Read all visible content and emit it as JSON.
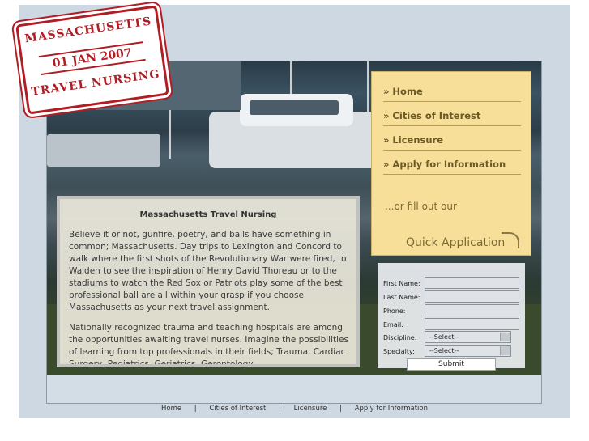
{
  "stamp": {
    "line1": "MASSACHUSETTS",
    "line2": "01 JAN 2007",
    "line3": "TRAVEL NURSING"
  },
  "nav": {
    "items": [
      {
        "label": "» Home"
      },
      {
        "label": "» Cities of Interest"
      },
      {
        "label": "» Licensure"
      },
      {
        "label": "» Apply for Information"
      }
    ],
    "or_fill": "...or fill out our",
    "quick_application": "Quick Application"
  },
  "content": {
    "title": "Massachusetts Travel Nursing",
    "paragraph1": "Believe it or not, gunfire, poetry, and balls have something in common; Massachusetts.  Day trips to Lexington and Concord to walk where the first shots of the Revolutionary War were fired, to Walden to see the inspiration of Henry David Thoreau or to the stadiums to watch the Red Sox or Patriots play some of the best professional ball are all within your grasp if you choose Massachusetts as your next travel assignment.",
    "paragraph2": "Nationally recognized trauma and teaching hospitals are among the opportunities awaiting travel nurses.  Imagine the possibilities of learning from top professionals in their fields; Trauma, Cardiac Surgery, Pediatrics, Geriatrics, Gerontology..."
  },
  "form": {
    "first_name_label": "First Name:",
    "last_name_label": "Last Name:",
    "phone_label": "Phone:",
    "email_label": "Email:",
    "discipline_label": "Discipline:",
    "discipline_value": "--Select--",
    "specialty_label": "Specialty:",
    "specialty_value": "--Select--",
    "submit_label": "Submit"
  },
  "footer": {
    "links": [
      "Home",
      "Cities of Interest",
      "Licensure",
      "Apply for Information"
    ],
    "separator": "|"
  }
}
